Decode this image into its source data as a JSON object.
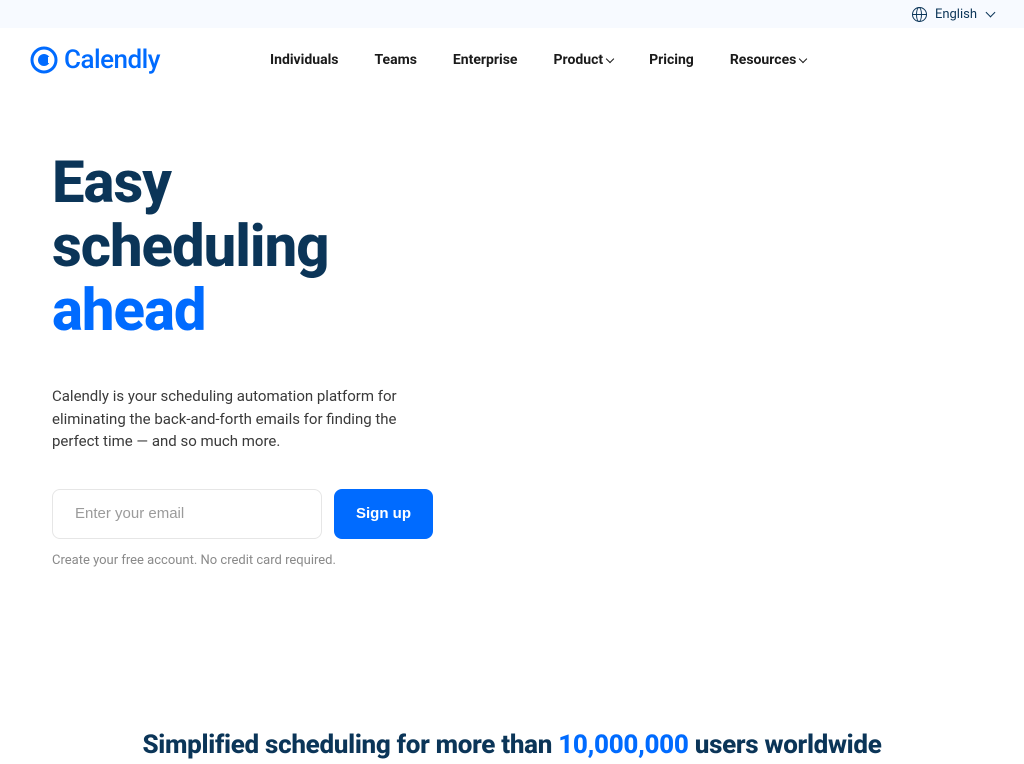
{
  "topbar": {
    "language": "English"
  },
  "brand": {
    "name": "Calendly"
  },
  "nav": {
    "items": [
      {
        "label": "Individuals",
        "dropdown": false
      },
      {
        "label": "Teams",
        "dropdown": false
      },
      {
        "label": "Enterprise",
        "dropdown": false
      },
      {
        "label": "Product",
        "dropdown": true
      },
      {
        "label": "Pricing",
        "dropdown": false
      },
      {
        "label": "Resources",
        "dropdown": true
      }
    ]
  },
  "hero": {
    "title_line1": "Easy",
    "title_line2": "scheduling",
    "title_accent": "ahead",
    "subtitle": "Calendly is your scheduling automation platform for eliminating the back-and-forth emails for finding the perfect time — and so much more.",
    "email_placeholder": "Enter your email",
    "signup_label": "Sign up",
    "disclaimer": "Create your free account. No credit card required."
  },
  "stat": {
    "prefix": "Simplified scheduling for more than ",
    "number": "10,000,000",
    "suffix": " users worldwide"
  }
}
